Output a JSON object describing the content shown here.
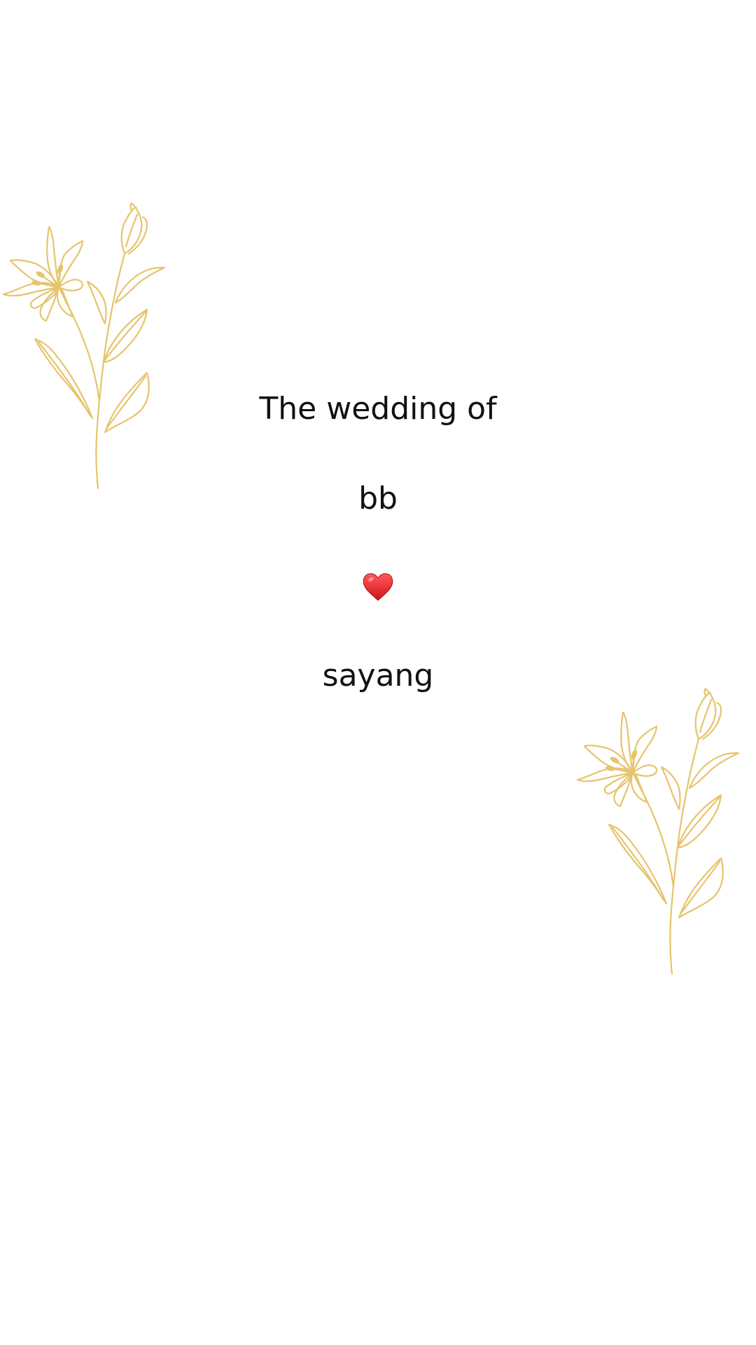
{
  "invitation": {
    "title": "The wedding of",
    "name_one": "bb",
    "heart_icon": "red-heart-icon",
    "name_two": "sayang"
  },
  "decor": {
    "left_flower": "lily-flower-icon",
    "right_flower": "lily-flower-icon",
    "flower_color": "#E6C46B",
    "heart_color": "#E0242B"
  }
}
